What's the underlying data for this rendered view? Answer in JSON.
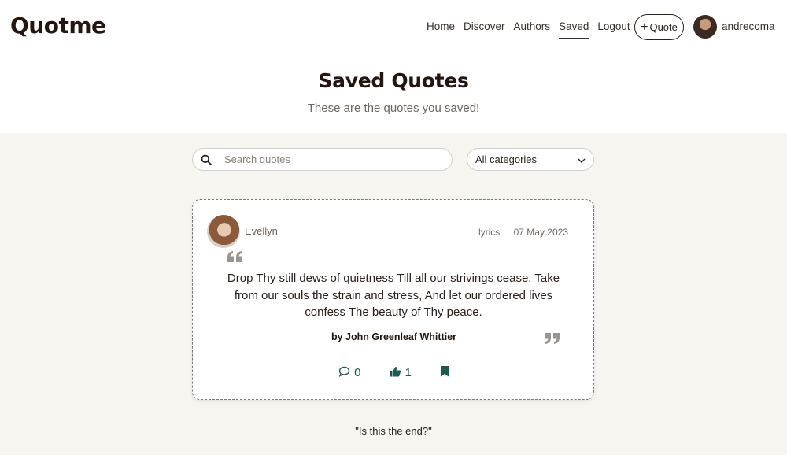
{
  "app": {
    "logo": "Quotme"
  },
  "nav": {
    "items": [
      {
        "label": "Home"
      },
      {
        "label": "Discover"
      },
      {
        "label": "Authors"
      },
      {
        "label": "Saved"
      },
      {
        "label": "Logout"
      }
    ],
    "active": "Saved",
    "quote_button": "Quote",
    "username": "andrecoma"
  },
  "hero": {
    "title": "Saved Quotes",
    "subtitle": "These are the quotes you saved!"
  },
  "filters": {
    "search_placeholder": "Search quotes",
    "search_value": "",
    "category_selected": "All categories"
  },
  "quote_card": {
    "user": "Evellyn",
    "category": "lyrics",
    "date": "07 May 2023",
    "text": "Drop Thy still dews of quietness Till all our strivings cease. Take from our souls the strain and stress, And let our ordered lives confess The beauty of Thy peace.",
    "author_line": "by John Greenleaf Whittier",
    "comments": "0",
    "likes": "1"
  },
  "footer": {
    "end_text": "\"Is this the end?\""
  },
  "colors": {
    "accent": "#1d5a55",
    "text": "#2b211d",
    "background": "#f7f5f0"
  }
}
